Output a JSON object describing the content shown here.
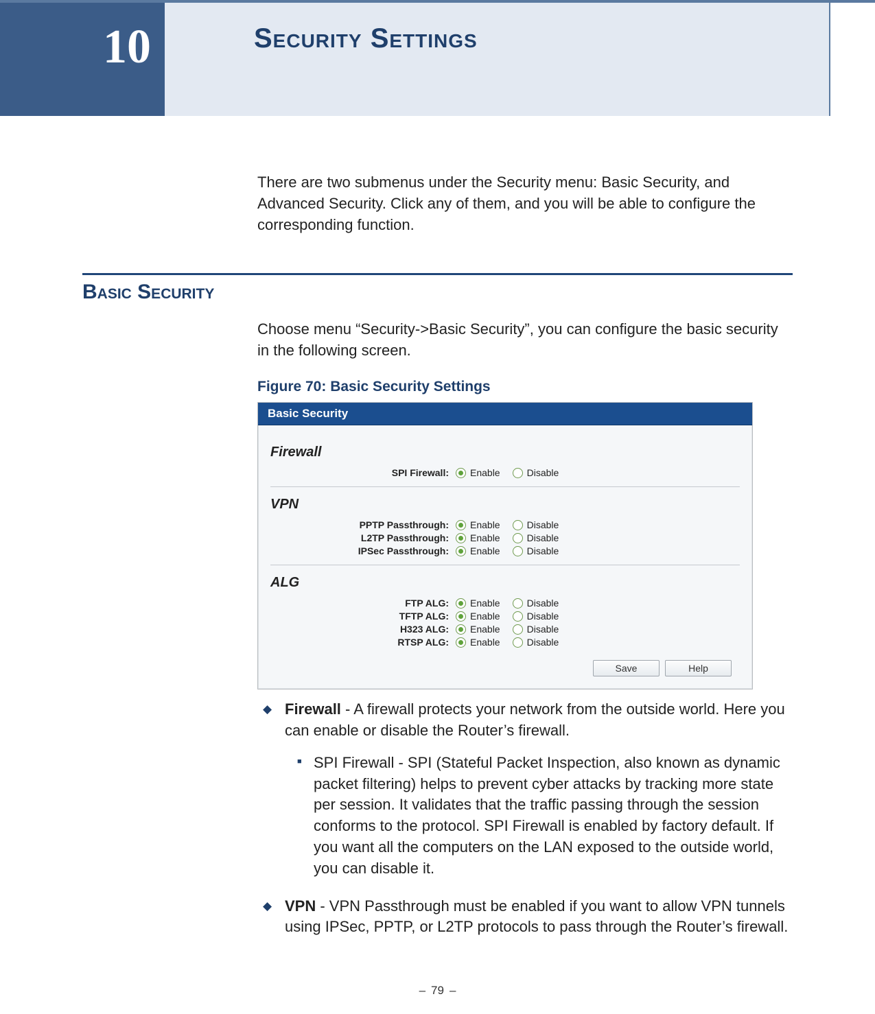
{
  "chapter": {
    "number": "10",
    "title": "Security Settings"
  },
  "intro": "There are two submenus under the Security menu: Basic Security, and Advanced Security. Click any of them, and you will be able to configure the corresponding function.",
  "section": {
    "title": "Basic Security",
    "lead": "Choose menu “Security->Basic Security”, you can configure the basic security in the following screen.",
    "figure_caption": "Figure 70:  Basic Security Settings"
  },
  "shot": {
    "title": "Basic Security",
    "enable": "Enable",
    "disable": "Disable",
    "groups": [
      {
        "name": "Firewall",
        "rows": [
          {
            "label": "SPI Firewall:",
            "value": "enable"
          }
        ]
      },
      {
        "name": "VPN",
        "rows": [
          {
            "label": "PPTP Passthrough:",
            "value": "enable"
          },
          {
            "label": "L2TP Passthrough:",
            "value": "enable"
          },
          {
            "label": "IPSec Passthrough:",
            "value": "enable"
          }
        ]
      },
      {
        "name": "ALG",
        "rows": [
          {
            "label": "FTP ALG:",
            "value": "enable"
          },
          {
            "label": "TFTP ALG:",
            "value": "enable"
          },
          {
            "label": "H323 ALG:",
            "value": "enable"
          },
          {
            "label": "RTSP ALG:",
            "value": "enable"
          }
        ]
      }
    ],
    "buttons": {
      "save": "Save",
      "help": "Help"
    }
  },
  "bullets": {
    "firewall": {
      "term": "Firewall",
      "desc": " - A firewall protects your network from the outside world. Here you can enable or disable the Router’s firewall.",
      "spi": "SPI Firewall - SPI (Stateful Packet Inspection, also known as dynamic packet filtering) helps to prevent cyber attacks by tracking more state per session. It validates that the traffic passing through the session conforms to the protocol. SPI Firewall is enabled by factory default. If you want all the computers on the LAN exposed to the outside world, you can disable it."
    },
    "vpn": {
      "term": "VPN",
      "desc": " - VPN Passthrough must be enabled if you want to allow VPN tunnels using IPSec, PPTP, or L2TP protocols to pass through the Router’s firewall."
    }
  },
  "footer": {
    "page": "79"
  }
}
